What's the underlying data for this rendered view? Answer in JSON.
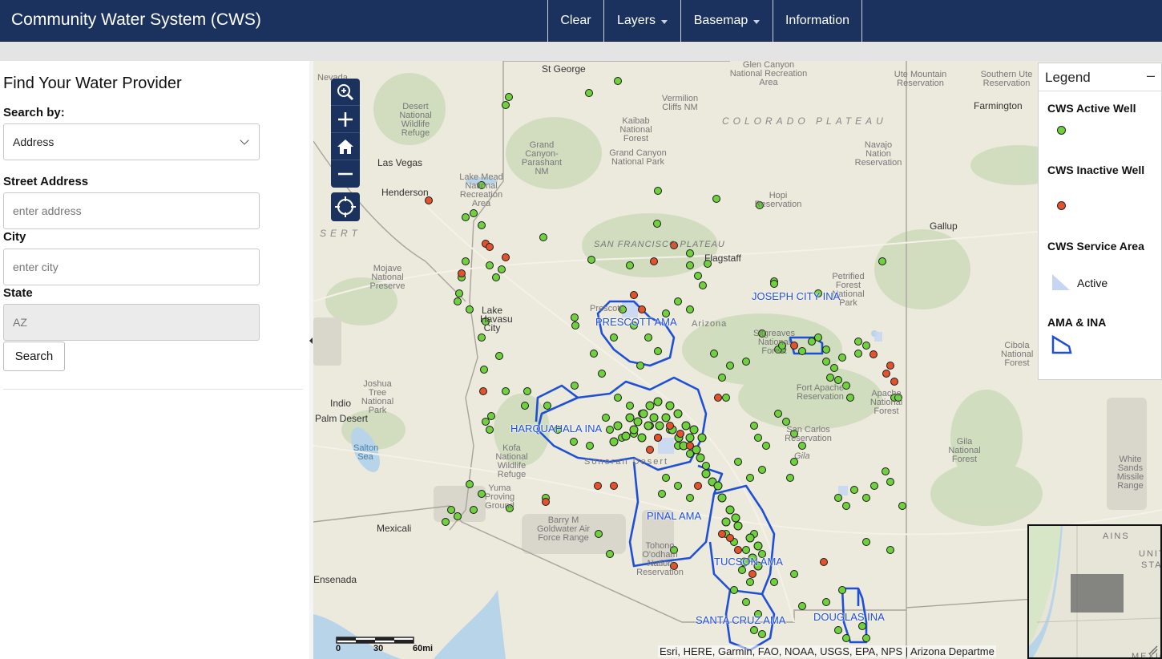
{
  "header": {
    "title": "Community Water System (CWS)",
    "nav": [
      {
        "label": "Clear",
        "dropdown": false
      },
      {
        "label": "Layers",
        "dropdown": true
      },
      {
        "label": "Basemap",
        "dropdown": true
      },
      {
        "label": "Information",
        "dropdown": false
      }
    ]
  },
  "sidebar": {
    "title": "Find Your Water Provider",
    "search_by_label": "Search by:",
    "search_by_value": "Address",
    "street_label": "Street Address",
    "street_placeholder": "enter address",
    "city_label": "City",
    "city_placeholder": "enter city",
    "state_label": "State",
    "state_value": "AZ",
    "search_button": "Search"
  },
  "legend": {
    "title": "Legend",
    "minimize": "–",
    "items": [
      {
        "label": "CWS Active Well",
        "color": "#6fd13c"
      },
      {
        "label": "CWS Inactive Well",
        "color": "#e2522c"
      },
      {
        "label": "CWS Service Area",
        "swatch_label": "Active",
        "color": "#c5d6f5"
      },
      {
        "label": "AMA & INA",
        "color": "#1f4fd6"
      }
    ]
  },
  "map": {
    "ama_labels": [
      "JOSEPH CITY INA",
      "PRESCOTT AMA",
      "HARQUAHALA INA",
      "PINAL AMA",
      "TUCSON AMA",
      "SANTA CRUZ AMA",
      "DOUGLAS INA"
    ],
    "place_labels": [
      "St George",
      "Las Vegas",
      "Henderson",
      "Lake Havasu City",
      "Indio",
      "Palm Desert",
      "Mexicali",
      "Farmington",
      "Gallup",
      "Flagstaff",
      "Prescott",
      "Hopi Reservation",
      "Navajo Nation Reservation",
      "Fort Apache Reservation",
      "San Carlos Reservation",
      "Mojave National Preserve",
      "Joshua Tree National Park",
      "Salton Sea",
      "Kofa National Wildlife Refuge",
      "Yuma Proving Ground",
      "Barry M Goldwater Air Force Range",
      "Tohono O'odham Nation Reservation",
      "Gila National Forest",
      "Ute Mountain Reservation",
      "Southern Ute Reservation",
      "Glen Canyon National Recreation Area",
      "Vermilion Cliffs NM",
      "Kaibab National Forest",
      "Grand Canyon National Park",
      "Grand Canyon-Parashant NM",
      "Lake Mead National Recreation Area",
      "Desert National Wildlife Refuge",
      "Petrified Forest National Park",
      "Sitgreaves National Forest",
      "Apache National Forest",
      "Cibola National Forest",
      "White Sands Missile Range",
      "Nevada",
      "Arizona",
      "Sonoran Desert",
      "Ensenada",
      "COLORADO PLATEAU",
      "SAN FRANCISCO PLATEAU",
      "SERT",
      "Gila"
    ],
    "scale_ticks": [
      "0",
      "30",
      "60mi"
    ],
    "attribution": "Esri, HERE, Garmin, FAO, NOAA, USGS, EPA, NPS | Arizona Departme",
    "overview_labels": [
      "UNIT",
      "STAT",
      "MEXIC",
      "AINS"
    ]
  }
}
